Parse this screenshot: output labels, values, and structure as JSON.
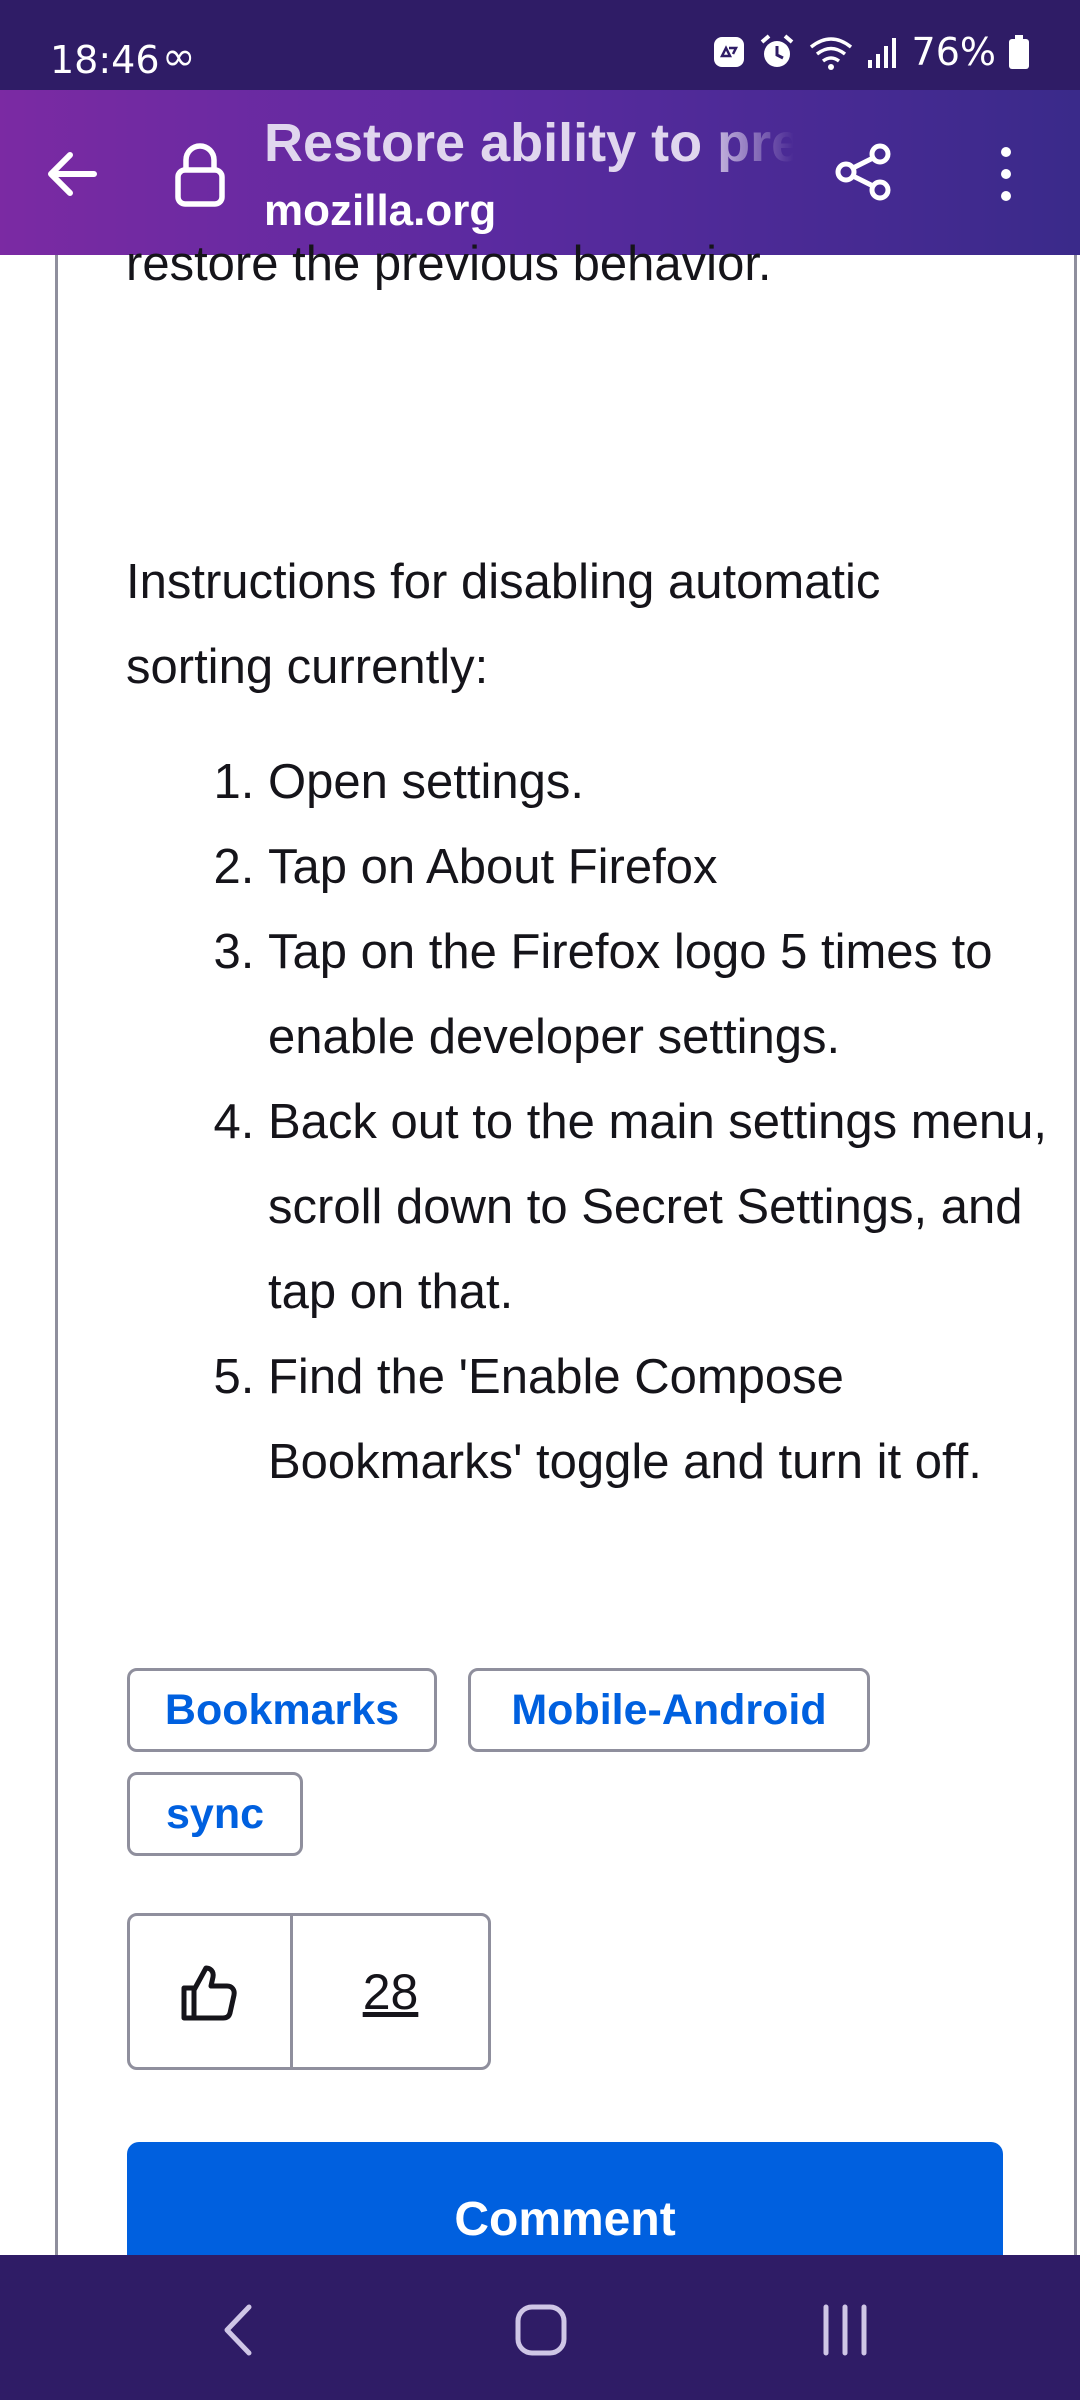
{
  "status_bar": {
    "time": "18:46",
    "battery": "76%",
    "icons": [
      "infinity-icon",
      "recycle-icon",
      "alarm-icon",
      "wifi-icon",
      "signal-icon",
      "battery-icon"
    ]
  },
  "toolbar": {
    "page_title": "Restore ability to preserve bookmark order",
    "domain": "mozilla.org",
    "icons": [
      "back-arrow-icon",
      "lock-icon",
      "share-icon",
      "more-vertical-icon"
    ]
  },
  "article": {
    "clipped_text": "restore the previous behavior.",
    "intro": "Instructions for disabling automatic sorting currently:",
    "steps": [
      "Open settings.",
      "Tap on About Firefox",
      "Tap on the Firefox logo 5 times to enable developer settings.",
      "Back out to the main settings menu, scroll down to Secret Settings, and tap on that.",
      "Find the 'Enable Compose Bookmarks' toggle and turn it off."
    ]
  },
  "tags": [
    "Bookmarks",
    "Mobile-Android",
    "sync"
  ],
  "votes": {
    "count": "28",
    "icon": "thumbs-up-icon"
  },
  "comment_button": "Comment",
  "nav_bar": {
    "icons": [
      "back-chevron-icon",
      "home-icon",
      "recents-icon"
    ]
  },
  "colors": {
    "status_bar": "#2f1c66",
    "toolbar_start": "#7b2aa3",
    "toolbar_end": "#3a2a8a",
    "link_blue": "#0060df",
    "border_gray": "#8f8f9d"
  }
}
